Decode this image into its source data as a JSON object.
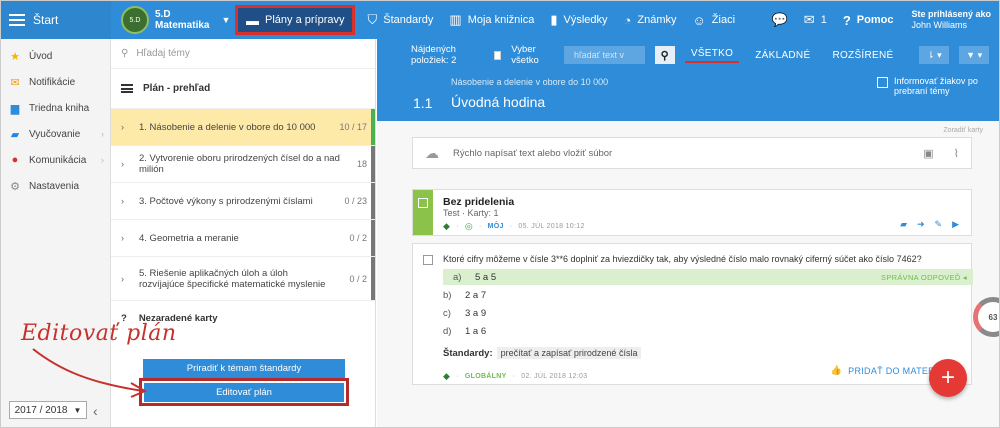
{
  "topbar": {
    "start": "Štart",
    "class_avatar_text": "5.D",
    "class_line1": "5.D",
    "class_line2": "Matematika",
    "plans": "Plány a prípravy",
    "standards": "Štandardy",
    "library": "Moja knižnica",
    "results": "Výsledky",
    "grades": "Známky",
    "students": "Žiaci",
    "messages_count": "1",
    "help": "Pomoc",
    "user_label": "Ste prihlásený ako",
    "user_name": "John Williams"
  },
  "leftnav": {
    "items": [
      {
        "label": "Úvod"
      },
      {
        "label": "Notifikácie"
      },
      {
        "label": "Triedna kniha"
      },
      {
        "label": "Vyučovanie"
      },
      {
        "label": "Komunikácia"
      },
      {
        "label": "Nastavenia"
      }
    ],
    "year": "2017 / 2018"
  },
  "plan": {
    "search_placeholder": "Hľadaj témy",
    "header": "Plán - prehľad",
    "topics": [
      {
        "name": "1. Násobenie a delenie v obore do 10 000",
        "count": "10 / 17"
      },
      {
        "name": "2. Vytvorenie oboru prirodzených čísel do a nad milión",
        "count": "18"
      },
      {
        "name": "3. Počtové výkony s prirodzenými číslami",
        "count": "0 / 23"
      },
      {
        "name": "4. Geometria a meranie",
        "count": "0 / 2"
      },
      {
        "name": "5. Riešenie aplikačných úloh a úloh rozvíjajúce špecifické matematické myslenie",
        "count": "0 / 2"
      }
    ],
    "unassigned_mark": "?",
    "unassigned": "Nezaradené karty",
    "btn_assign": "Priradiť k témam štandardy",
    "btn_edit": "Editovať plán"
  },
  "annotation": {
    "text": "Editovať plán"
  },
  "filter": {
    "found": "Nájdených položiek: 2",
    "select_all": "Vyber všetko",
    "search_placeholder": "hľadať text v",
    "tab_all": "VŠETKO",
    "tab_basic": "ZÁKLADNÉ",
    "tab_extended": "ROZŠÍRENÉ"
  },
  "lesson": {
    "topic": "Násobenie a delenie v obore do 10 000",
    "number": "1.1",
    "title": "Úvodná hodina",
    "inform_line1": "Informovať žiakov po",
    "inform_line2": "prebraní témy"
  },
  "quickwrite": {
    "placeholder": "Rýchlo napísať text alebo vložiť súbor",
    "corner_note": "Zoradiť karty"
  },
  "card1": {
    "title": "Bez pridelenia",
    "meta": "Test · Karty: 1",
    "owner": "MÔJ",
    "date": "05. JÚL 2018 10:12"
  },
  "card2": {
    "question": "Ktoré cifry môžeme v čísle 3**6 doplniť za hviezdičky tak, aby výsledné číslo malo rovnaký ciferný súčet ako číslo 7462?",
    "answers": [
      {
        "letter": "a)",
        "text": "5 a 5"
      },
      {
        "letter": "b)",
        "text": "2 a 7"
      },
      {
        "letter": "c)",
        "text": "3 a 9"
      },
      {
        "letter": "d)",
        "text": "1 a 6"
      }
    ],
    "correct_label": "SPRÁVNA ODPOVEĎ",
    "standards_label": "Štandardy:",
    "standard": "prečítať a zapísať prirodzené čísla",
    "scope": "GLOBÁLNY",
    "date": "02. JÚL 2018 12:03",
    "add_material": "PRIDAŤ DO MATERIÁLOV"
  },
  "progress": {
    "value": 63,
    "label": "63"
  },
  "colors": {
    "brand": "#2f8cd8",
    "accent": "#e53935",
    "highlight": "#d9302c"
  }
}
